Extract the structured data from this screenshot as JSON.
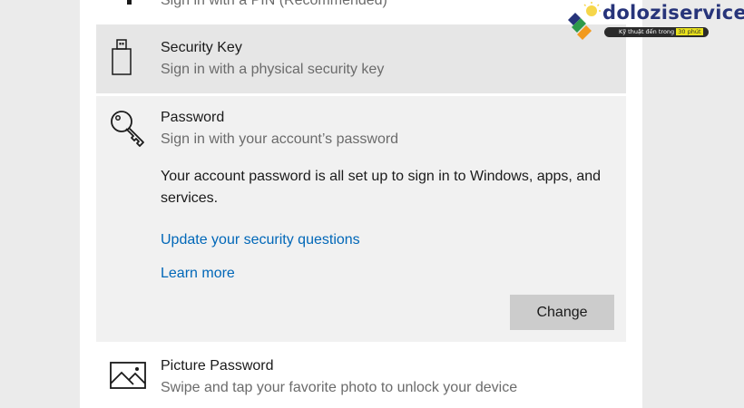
{
  "options": {
    "pin": {
      "subtitle": "Sign in with a PIN (Recommended)"
    },
    "security_key": {
      "title": "Security Key",
      "subtitle": "Sign in with a physical security key",
      "icon": "usb-key-icon"
    },
    "password": {
      "title": "Password",
      "subtitle": "Sign in with your account’s password",
      "description": "Your account password is all set up to sign in to Windows, apps, and services.",
      "link_security_questions": "Update your security questions",
      "link_learn_more": "Learn more",
      "change_label": "Change",
      "icon": "key-icon"
    },
    "picture_password": {
      "title": "Picture Password",
      "subtitle": "Swipe and tap your favorite photo to unlock your device",
      "icon": "picture-icon"
    }
  },
  "watermark": {
    "name": "doloziservice",
    "tagline_prefix": "Kỹ thuật đến trong",
    "tagline_highlight": "30 phút"
  },
  "colors": {
    "link": "#0067b8",
    "selected_row": "#e6e6e6",
    "expanded_row": "#f1f1f1",
    "button": "#cccccc",
    "brand": "#27347a"
  }
}
